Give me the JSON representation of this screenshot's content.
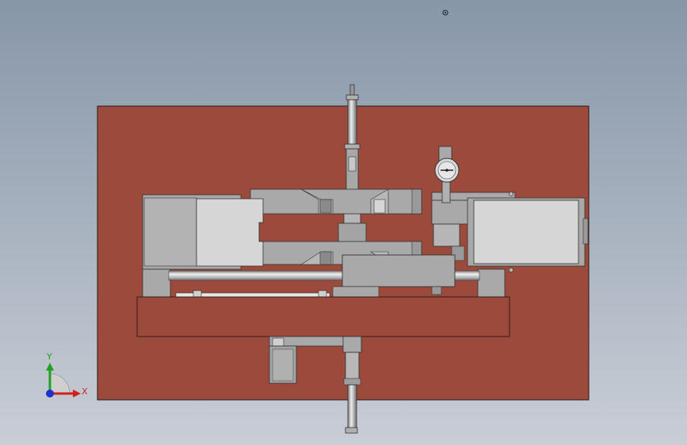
{
  "viewport": {
    "colors": {
      "background_top": "#8796a8",
      "background_bottom": "#c9ced6",
      "base_plate": "#9b4a3c",
      "part_gray": "#a9a9a9",
      "part_light": "#d4d4d4",
      "rod_steel": "#c8c8c8"
    }
  },
  "triad": {
    "x_label": "X",
    "y_label": "Y",
    "x_color": "#d02020",
    "y_color": "#20a020",
    "z_color": "#2030d0"
  },
  "gauge": {
    "icon": "dial-gauge-icon"
  },
  "reference_point": {
    "icon": "origin-marker-icon"
  }
}
